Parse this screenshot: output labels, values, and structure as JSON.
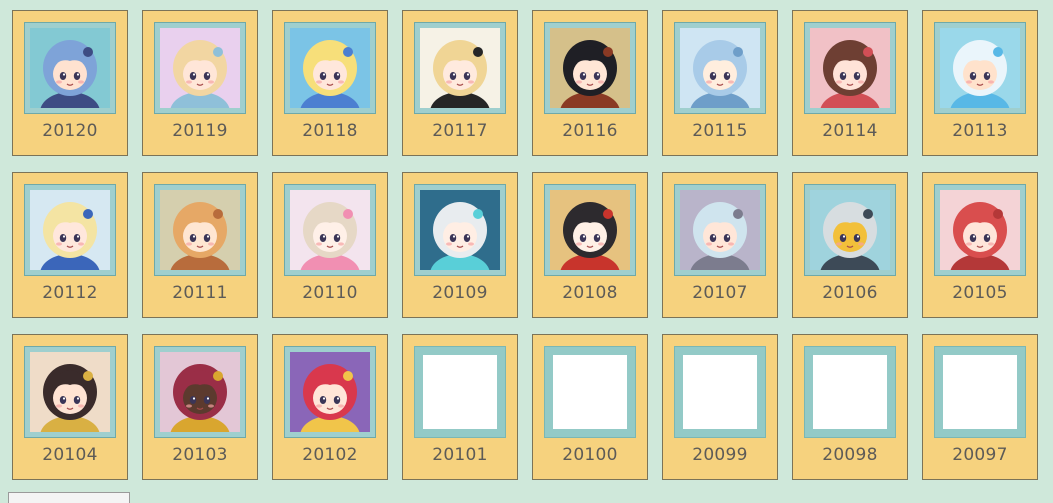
{
  "cards": [
    {
      "id": "20120",
      "icon": "avatar-blue-hair-boy-icon",
      "hair": "#7ea3d8",
      "skin": "#ffe2d0",
      "bg": "#83c9d3",
      "accent": "#3d4c84",
      "empty": false
    },
    {
      "id": "20119",
      "icon": "avatar-blonde-girl-icon",
      "hair": "#f2d6a2",
      "skin": "#ffe6d8",
      "bg": "#e9d0ee",
      "accent": "#8fc0d9",
      "empty": false
    },
    {
      "id": "20118",
      "icon": "avatar-blonde-princess-icon",
      "hair": "#f7df7a",
      "skin": "#ffe7db",
      "bg": "#7bc4e6",
      "accent": "#4c7fd1",
      "empty": false
    },
    {
      "id": "20117",
      "icon": "avatar-half-black-hair-girl-icon",
      "hair": "#f0d595",
      "skin": "#ffeade",
      "bg": "#f6f2e6",
      "accent": "#262626",
      "empty": false
    },
    {
      "id": "20116",
      "icon": "avatar-crown-black-hair-girl-icon",
      "hair": "#1f1f25",
      "skin": "#ffe6d6",
      "bg": "#d5c08a",
      "accent": "#8a3a24",
      "empty": false
    },
    {
      "id": "20115",
      "icon": "avatar-ice-blue-hair-girl-icon",
      "hair": "#a8cbe8",
      "skin": "#ffeede",
      "bg": "#cfe5f3",
      "accent": "#6e9ec9",
      "empty": false
    },
    {
      "id": "20114",
      "icon": "avatar-brown-hair-girl-icon",
      "hair": "#6e3f33",
      "skin": "#ffe3d8",
      "bg": "#f1c1c6",
      "accent": "#d24f56",
      "empty": false
    },
    {
      "id": "20113",
      "icon": "avatar-dolphin-hood-kid-icon",
      "hair": "#eaf5fb",
      "skin": "#ffe2cc",
      "bg": "#9ad8ea",
      "accent": "#58b8e6",
      "empty": false
    },
    {
      "id": "20112",
      "icon": "avatar-blonde-boy-blue-cape-icon",
      "hair": "#f4e4a3",
      "skin": "#ffe7dc",
      "bg": "#d6e8f2",
      "accent": "#3b66ba",
      "empty": false
    },
    {
      "id": "20111",
      "icon": "avatar-tiger-hood-kid-icon",
      "hair": "#e6a866",
      "skin": "#ffe6d2",
      "bg": "#d5cfae",
      "accent": "#b86c3c",
      "empty": false
    },
    {
      "id": "20110",
      "icon": "avatar-pink-flower-girl-icon",
      "hair": "#e6d8c6",
      "skin": "#fff0e8",
      "bg": "#f3e4ee",
      "accent": "#f18fb2",
      "empty": false
    },
    {
      "id": "20109",
      "icon": "avatar-silver-hair-girl-icon",
      "hair": "#e8ecef",
      "skin": "#ffeee4",
      "bg": "#2f6d8c",
      "accent": "#59cfd8",
      "empty": false
    },
    {
      "id": "20108",
      "icon": "avatar-opera-queen-icon",
      "hair": "#2d2a2e",
      "skin": "#fff0e6",
      "bg": "#e6c27f",
      "accent": "#c8342c",
      "empty": false
    },
    {
      "id": "20107",
      "icon": "avatar-wolf-hood-boy-icon",
      "hair": "#cfe4ee",
      "skin": "#ffe6d8",
      "bg": "#b9b4ca",
      "accent": "#7c7c8e",
      "empty": false
    },
    {
      "id": "20106",
      "icon": "robot-head-icon",
      "hair": "#d7dde0",
      "skin": "#f2c03a",
      "bg": "#9fd3dd",
      "accent": "#3d4a57",
      "empty": false
    },
    {
      "id": "20105",
      "icon": "avatar-red-hood-girl-icon",
      "hair": "#d94e4e",
      "skin": "#ffe5da",
      "bg": "#f4d3d6",
      "accent": "#b43838",
      "empty": false
    },
    {
      "id": "20104",
      "icon": "avatar-purple-eyes-girl-icon",
      "hair": "#3a2b2b",
      "skin": "#ffe3d3",
      "bg": "#efdcc8",
      "accent": "#d9b043",
      "empty": false
    },
    {
      "id": "20103",
      "icon": "avatar-dark-masked-figure-icon",
      "hair": "#9a2e47",
      "skin": "#5c3a2e",
      "bg": "#e3c7d6",
      "accent": "#d9a62f",
      "empty": false
    },
    {
      "id": "20102",
      "icon": "avatar-red-hair-horned-girl-icon",
      "hair": "#d9384d",
      "skin": "#ffe5d8",
      "bg": "#8a66b8",
      "accent": "#f1c54a",
      "empty": false
    },
    {
      "id": "20101",
      "icon": "empty-frame-icon",
      "empty": true
    },
    {
      "id": "20100",
      "icon": "empty-frame-icon",
      "empty": true
    },
    {
      "id": "20099",
      "icon": "empty-frame-icon",
      "empty": true
    },
    {
      "id": "20098",
      "icon": "empty-frame-icon",
      "empty": true
    },
    {
      "id": "20097",
      "icon": "empty-frame-icon",
      "empty": true
    }
  ]
}
